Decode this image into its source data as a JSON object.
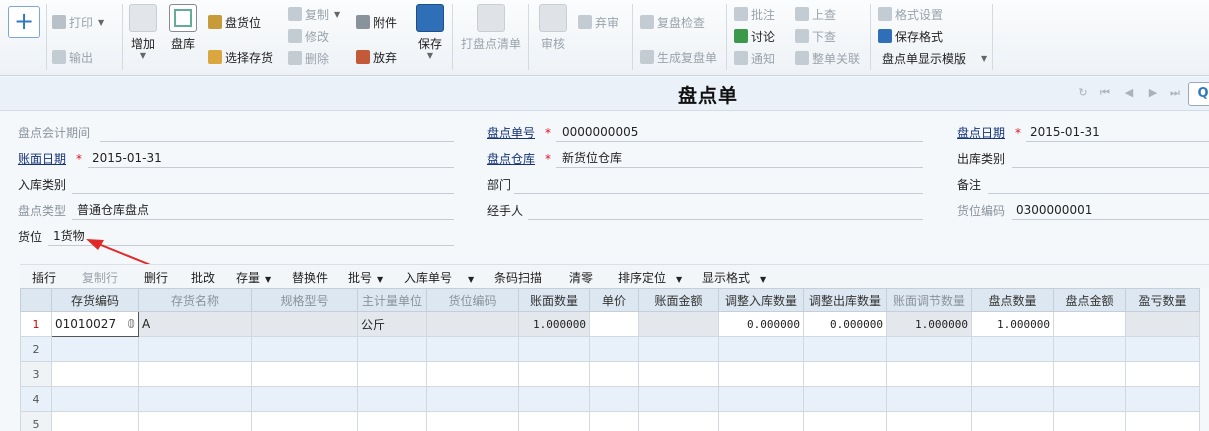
{
  "toolbar": {
    "print": "打印",
    "export": "输出",
    "add": "增加",
    "stocktake": "盘库",
    "stock_location": "盘货位",
    "select_stock": "选择存货",
    "copy": "复制",
    "modify": "修改",
    "delete": "删除",
    "attachment": "附件",
    "abandon": "放弃",
    "save": "保存",
    "print_list": "打盘点清单",
    "audit": "审核",
    "discard_audit": "弃审",
    "recheck": "复盘检查",
    "gen_recheck": "生成复盘单",
    "annotate": "批注",
    "discuss": "讨论",
    "notify": "通知",
    "prev": "上查",
    "next": "下查",
    "relation": "整单关联",
    "format_settings": "格式设置",
    "save_format": "保存格式",
    "template": "盘点单显示模版"
  },
  "title": "盘点单",
  "form": {
    "accounting_period_label": "盘点会计期间",
    "doc_no_label": "盘点单号",
    "doc_no": "0000000005",
    "check_date_label": "盘点日期",
    "check_date": "2015-01-31",
    "book_date_label": "账面日期",
    "book_date": "2015-01-31",
    "warehouse_label": "盘点仓库",
    "warehouse": "新货位仓库",
    "out_type_label": "出库类别",
    "in_type_label": "入库类别",
    "dept_label": "部门",
    "remark_label": "备注",
    "check_type_label": "盘点类型",
    "check_type": "普通仓库盘点",
    "handler_label": "经手人",
    "location_code_label": "货位编码",
    "location_code": "0300000001",
    "location_label": "货位",
    "location": "1货物"
  },
  "grid_toolbar": {
    "insert_row": "插行",
    "copy_row": "复制行",
    "delete_row": "删行",
    "batch_edit": "批改",
    "stock": "存量",
    "substitute": "替换件",
    "batch_no": "批号",
    "in_doc_no": "入库单号",
    "barcode": "条码扫描",
    "clear_zero": "清零",
    "sort": "排序定位",
    "display_format": "显示格式"
  },
  "columns": [
    "存货编码",
    "存货名称",
    "规格型号",
    "主计量单位",
    "货位编码",
    "账面数量",
    "单价",
    "账面金额",
    "调整入库数量",
    "调整出库数量",
    "账面调节数量",
    "盘点数量",
    "盘点金额",
    "盈亏数量"
  ],
  "rows": [
    {
      "no": "1",
      "code": "01010027",
      "name": "A",
      "spec": "",
      "unit": "公斤",
      "loc": "",
      "book_qty": "1.000000",
      "price": "",
      "book_amt": "",
      "adj_in": "0.000000",
      "adj_out": "0.000000",
      "adj_book": "1.000000",
      "check_qty": "1.000000",
      "check_amt": "",
      "diff": ""
    },
    {
      "no": "2"
    },
    {
      "no": "3"
    },
    {
      "no": "4"
    },
    {
      "no": "5"
    }
  ]
}
